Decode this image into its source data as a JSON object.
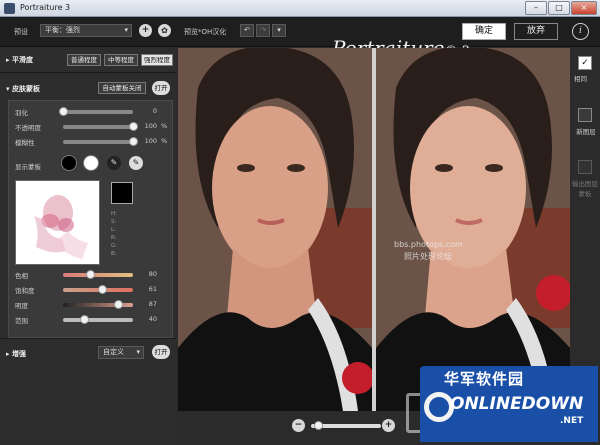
{
  "window": {
    "title": "Portraiture 3",
    "controls": [
      "–",
      "□",
      "×"
    ]
  },
  "toolbar": {
    "preset_label": "预设",
    "preset_value": "平衡：强烈",
    "preview_label": "预览*OH汉化",
    "brand": "Portraiture",
    "brand_version": "® 3",
    "ok": "确定",
    "cancel": "放弃",
    "info": "i",
    "add": "+",
    "gear": "✿"
  },
  "sidebar": {
    "smoothing": {
      "title": "平滑度",
      "buttons": [
        "普通程度",
        "中等程度",
        "强烈程度"
      ],
      "selected": 2
    },
    "skin_mask": {
      "title": "皮肤蒙板",
      "auto_btn": "自动蒙板关闭",
      "toggle": "打开"
    },
    "sliders_top": [
      {
        "label": "羽化",
        "value": "0",
        "unit": "",
        "level": 0
      },
      {
        "label": "不透明度",
        "value": "100",
        "unit": "%",
        "level": 1
      },
      {
        "label": "模糊性",
        "value": "100",
        "unit": "%",
        "level": 1
      }
    ],
    "show_mask": "显示蒙板",
    "readouts": [
      "H:",
      "S:",
      "L:",
      "R:",
      "G:",
      "B:"
    ],
    "sliders_bottom": [
      {
        "label": "色相",
        "value": "80",
        "level": 0.38
      },
      {
        "label": "饱和度",
        "value": "61",
        "level": 0.55
      },
      {
        "label": "明度",
        "value": "87",
        "level": 0.78
      },
      {
        "label": "范围",
        "value": "40",
        "level": 0.3
      }
    ],
    "enhance": {
      "title": "增强",
      "mode": "自定义",
      "toggle": "打开"
    }
  },
  "right": {
    "compare": "相同",
    "new_layer": "新图层",
    "output_mask": "输出图层蒙板"
  },
  "watermark": {
    "line1": "bbs.photops.com",
    "line2": "照片处理论坛"
  },
  "badge": {
    "cn": "华军软件园",
    "en": "ONLINEDOWN",
    "tld": ".NET"
  },
  "zoom": {
    "minus": "−",
    "plus": "+",
    "level": 0.1
  },
  "colors": {
    "accent": "#1a4fa8",
    "bg": "#2b2b2b"
  }
}
